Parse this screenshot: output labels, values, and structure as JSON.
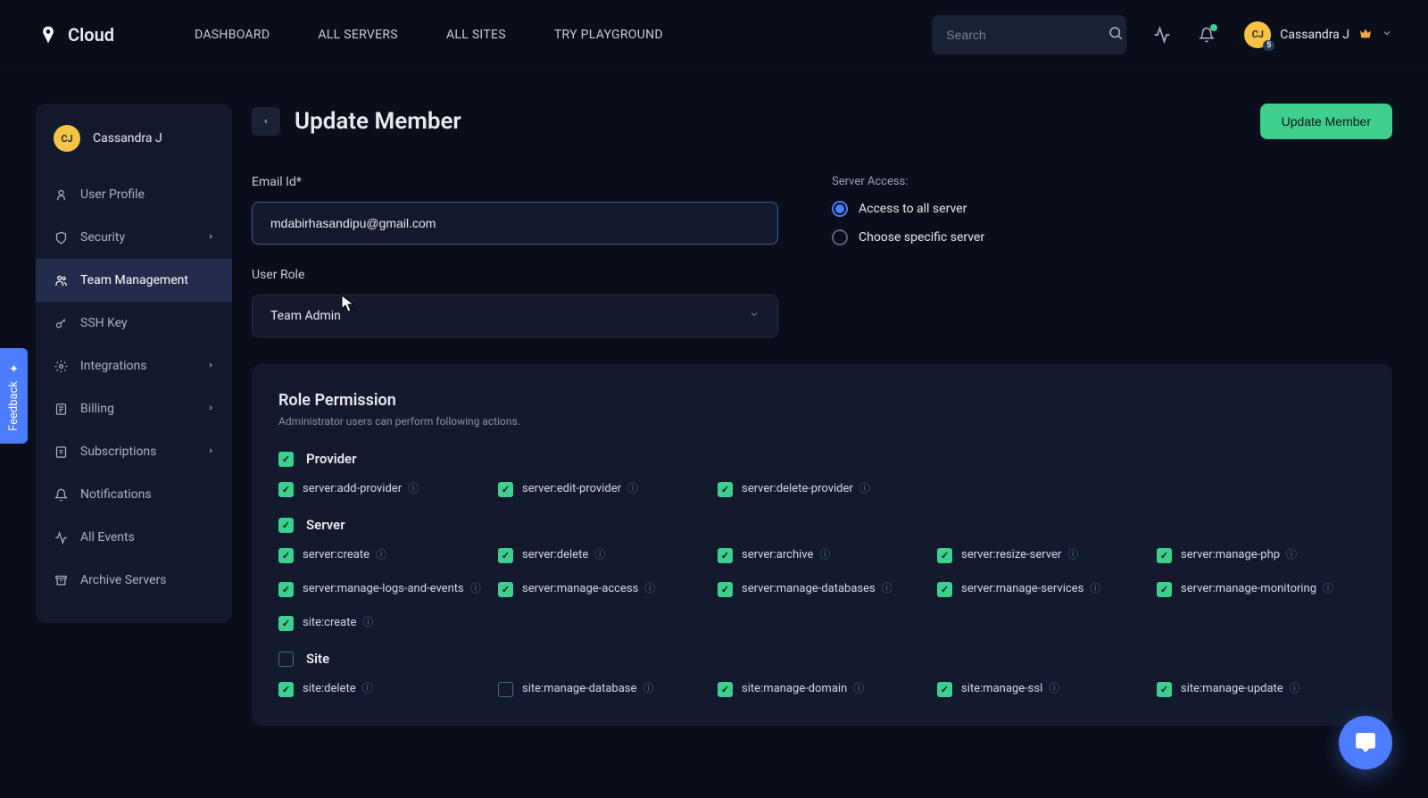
{
  "brand": "Cloud",
  "nav": [
    "DASHBOARD",
    "ALL SERVERS",
    "ALL SITES",
    "TRY PLAYGROUND"
  ],
  "search": {
    "placeholder": "Search"
  },
  "user": {
    "name": "Cassandra J",
    "initials": "CJ",
    "badge": "5"
  },
  "sidebar": {
    "profile_name": "Cassandra J",
    "items": [
      {
        "label": "User Profile",
        "icon": "user-icon",
        "chevron": false,
        "active": false
      },
      {
        "label": "Security",
        "icon": "shield-icon",
        "chevron": true,
        "active": false
      },
      {
        "label": "Team Management",
        "icon": "team-icon",
        "chevron": false,
        "active": true
      },
      {
        "label": "SSH Key",
        "icon": "key-icon",
        "chevron": false,
        "active": false
      },
      {
        "label": "Integrations",
        "icon": "gear-icon",
        "chevron": true,
        "active": false
      },
      {
        "label": "Billing",
        "icon": "billing-icon",
        "chevron": true,
        "active": false
      },
      {
        "label": "Subscriptions",
        "icon": "subscription-icon",
        "chevron": true,
        "active": false
      },
      {
        "label": "Notifications",
        "icon": "bell-icon",
        "chevron": false,
        "active": false
      },
      {
        "label": "All Events",
        "icon": "activity-icon",
        "chevron": false,
        "active": false
      },
      {
        "label": "Archive Servers",
        "icon": "archive-icon",
        "chevron": false,
        "active": false
      }
    ]
  },
  "page": {
    "title": "Update Member",
    "primary_button": "Update Member",
    "email_label": "Email Id*",
    "email_value": "mdabirhasandipu@gmail.com",
    "role_label": "User Role",
    "role_value": "Team Admin",
    "server_access_label": "Server Access:",
    "radios": [
      {
        "label": "Access to all server",
        "checked": true
      },
      {
        "label": "Choose specific server",
        "checked": false
      }
    ]
  },
  "permissions": {
    "title": "Role Permission",
    "subtitle": "Administrator users can perform following actions.",
    "groups": [
      {
        "name": "Provider",
        "group_checked": true,
        "items": [
          {
            "label": "server:add-provider",
            "checked": true
          },
          {
            "label": "server:edit-provider",
            "checked": true
          },
          {
            "label": "server:delete-provider",
            "checked": true
          }
        ]
      },
      {
        "name": "Server",
        "group_checked": true,
        "items": [
          {
            "label": "server:create",
            "checked": true
          },
          {
            "label": "server:delete",
            "checked": true
          },
          {
            "label": "server:archive",
            "checked": true
          },
          {
            "label": "server:resize-server",
            "checked": true
          },
          {
            "label": "server:manage-php",
            "checked": true
          },
          {
            "label": "server:manage-logs-and-events",
            "checked": true
          },
          {
            "label": "server:manage-access",
            "checked": true
          },
          {
            "label": "server:manage-databases",
            "checked": true
          },
          {
            "label": "server:manage-services",
            "checked": true
          },
          {
            "label": "server:manage-monitoring",
            "checked": true
          },
          {
            "label": "site:create",
            "checked": true
          }
        ]
      },
      {
        "name": "Site",
        "group_checked": false,
        "items": [
          {
            "label": "site:delete",
            "checked": true
          },
          {
            "label": "site:manage-database",
            "checked": false
          },
          {
            "label": "site:manage-domain",
            "checked": true
          },
          {
            "label": "site:manage-ssl",
            "checked": true
          },
          {
            "label": "site:manage-update",
            "checked": true
          }
        ]
      }
    ]
  },
  "feedback_label": "Feedback"
}
